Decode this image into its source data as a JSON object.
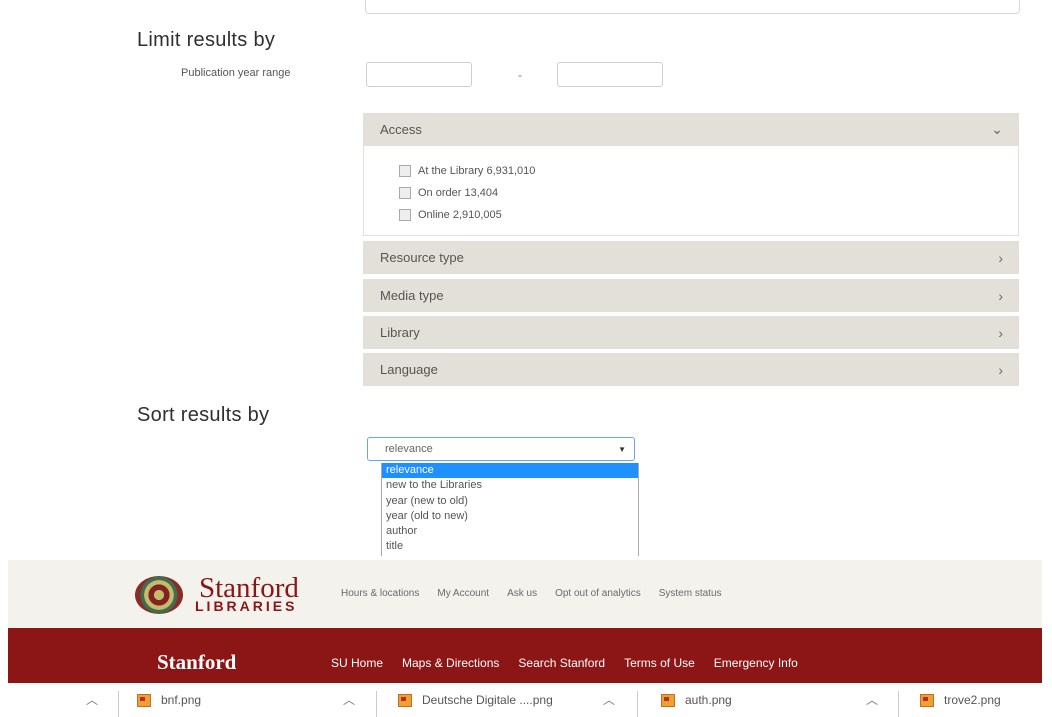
{
  "limit": {
    "heading": "Limit results by",
    "publication_year_label": "Publication year range",
    "year_separator": "-"
  },
  "facets": {
    "access": {
      "label": "Access",
      "items": [
        {
          "label": "At the Library 6,931,010"
        },
        {
          "label": "On order 13,404"
        },
        {
          "label": "Online 2,910,005"
        }
      ]
    },
    "resource_type": {
      "label": "Resource type"
    },
    "media_type": {
      "label": "Media type"
    },
    "library": {
      "label": "Library"
    },
    "language": {
      "label": "Language"
    }
  },
  "sort": {
    "heading": "Sort results by",
    "selected": "relevance",
    "options": [
      "relevance",
      "new to the Libraries",
      "year (new to old)",
      "year (old to new)",
      "author",
      "title"
    ]
  },
  "library_footer": {
    "logo_name": "Stanford",
    "logo_sub": "LIBRARIES",
    "links": [
      "Hours & locations",
      "My Account",
      "Ask us",
      "Opt out of analytics",
      "System status"
    ]
  },
  "university_footer": {
    "logo": "Stanford",
    "links": [
      "SU Home",
      "Maps & Directions",
      "Search Stanford",
      "Terms of Use",
      "Emergency Info"
    ]
  },
  "downloads": {
    "files": [
      "bnf.png",
      "Deutsche Digitale ....png",
      "auth.png",
      "trove2.png"
    ]
  },
  "colors": {
    "stanford_red": "#8c1515",
    "facet_bg": "#e2e0d9",
    "select_highlight": "#1e90ff"
  }
}
